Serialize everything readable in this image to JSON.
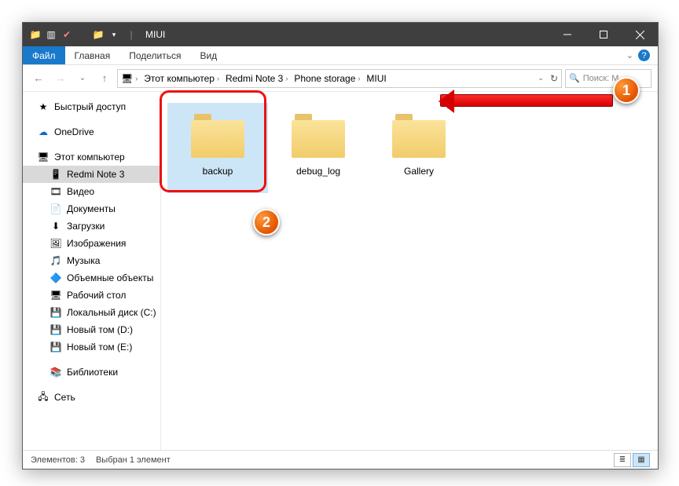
{
  "window_title": "MIUI",
  "tabs": {
    "file": "Файл",
    "home": "Главная",
    "share": "Поделиться",
    "view": "Вид"
  },
  "breadcrumb": [
    "Этот компьютер",
    "Redmi Note 3",
    "Phone storage",
    "MIUI"
  ],
  "search_placeholder": "Поиск: M...",
  "nav": {
    "quick": "Быстрый доступ",
    "onedrive": "OneDrive",
    "thispc": "Этот компьютер",
    "items": [
      "Redmi Note 3",
      "Видео",
      "Документы",
      "Загрузки",
      "Изображения",
      "Музыка",
      "Объемные объекты",
      "Рабочий стол",
      "Локальный диск (C:)",
      "Новый том (D:)",
      "Новый том (E:)",
      "Библиотеки"
    ],
    "network": "Сеть"
  },
  "folders": [
    "backup",
    "debug_log",
    "Gallery"
  ],
  "status": {
    "count": "Элементов: 3",
    "selected": "Выбран 1 элемент"
  },
  "badges": {
    "b1": "1",
    "b2": "2"
  },
  "nav_icons": [
    "📱",
    "🎞",
    "📄",
    "⬇",
    "🖼",
    "🎵",
    "🔷",
    "🖥",
    "💾",
    "💾",
    "💾",
    "📚"
  ],
  "colors": {
    "accent": "#1979ca"
  }
}
